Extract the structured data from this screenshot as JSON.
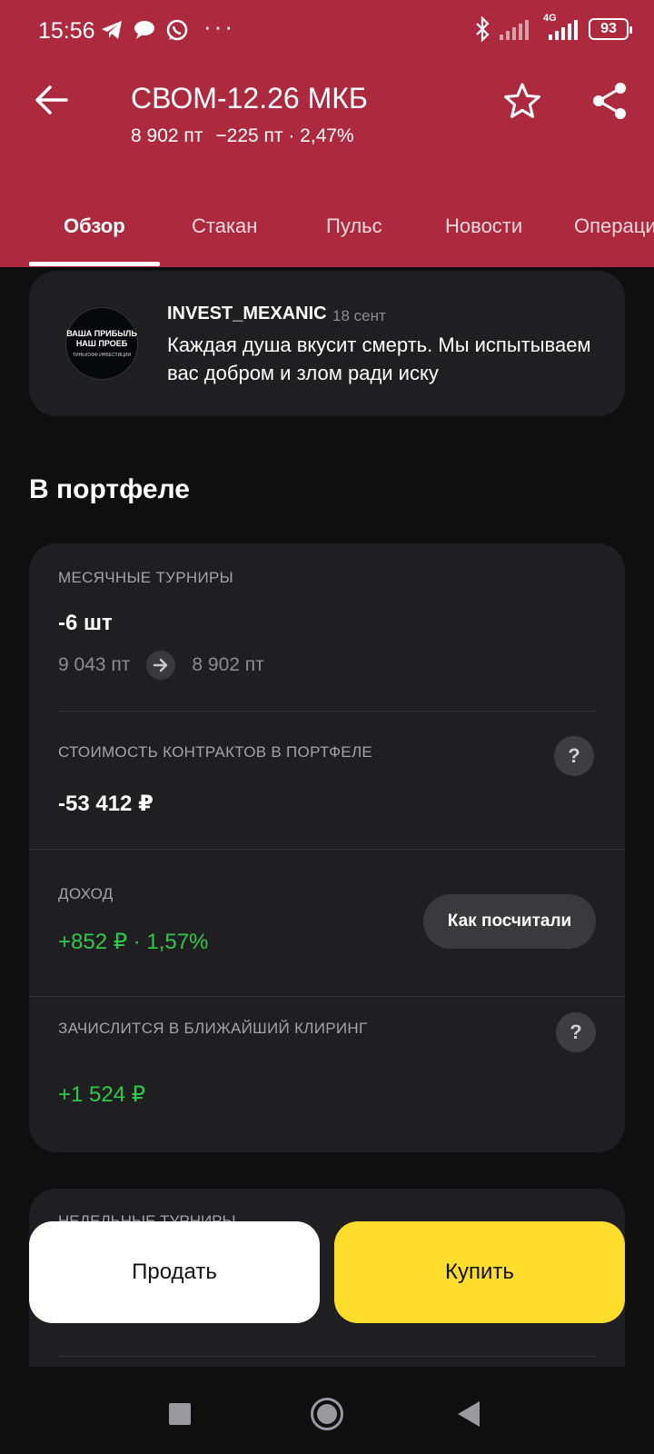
{
  "status_bar": {
    "time": "15:56",
    "battery": "93",
    "network": "4G"
  },
  "header": {
    "title": "СВОМ-12.26 МКБ",
    "price": "8 902 пт",
    "change": "−225 пт · 2,47%",
    "bg_color": "#ad2a3e"
  },
  "tabs": [
    {
      "label": "Обзор",
      "active": true
    },
    {
      "label": "Стакан",
      "active": false
    },
    {
      "label": "Пульс",
      "active": false
    },
    {
      "label": "Новости",
      "active": false
    },
    {
      "label": "Операци",
      "active": false
    }
  ],
  "pulse": {
    "author": "INVEST_MEXANIC",
    "date": "18 сент",
    "text": "Каждая душа вкусит смерть. Мы испытываем вас добром и злом ради иску",
    "avatar_line1": "ВАША ПРИБЫЛЬ",
    "avatar_line2": "НАШ ПРОЕБ",
    "avatar_line3": "ТИНЬКОФФ ИНВЕСТИЦИИ"
  },
  "portfolio": {
    "section_title": "В портфеле",
    "monthly_label": "МЕСЯЧНЫЕ ТУРНИРЫ",
    "quantity": "-6 шт",
    "price_from": "9 043 пт",
    "price_to": "8 902 пт",
    "contracts_label": "СТОИМОСТЬ КОНТРАКТОВ В ПОРТФЕЛЕ",
    "contracts_value": "-53 412 ₽",
    "income_label": "ДОХОД",
    "income_value": "+852 ₽ · 1,57%",
    "how_button": "Как посчитали",
    "clearing_label": "ЗАЧИСЛИТСЯ В БЛИЖАЙШИЙ КЛИРИНГ",
    "clearing_value": "+1 524 ₽",
    "help_symbol": "?"
  },
  "next_card": {
    "label": "НЕДЕЛЬНЫЕ ТУРНИРЫ"
  },
  "actions": {
    "sell": "Продать",
    "buy": "Купить",
    "buy_color": "#ffdd2d"
  },
  "colors": {
    "positive": "#2ec94a",
    "card": "#1f1f21",
    "background": "#0f0f0f"
  }
}
